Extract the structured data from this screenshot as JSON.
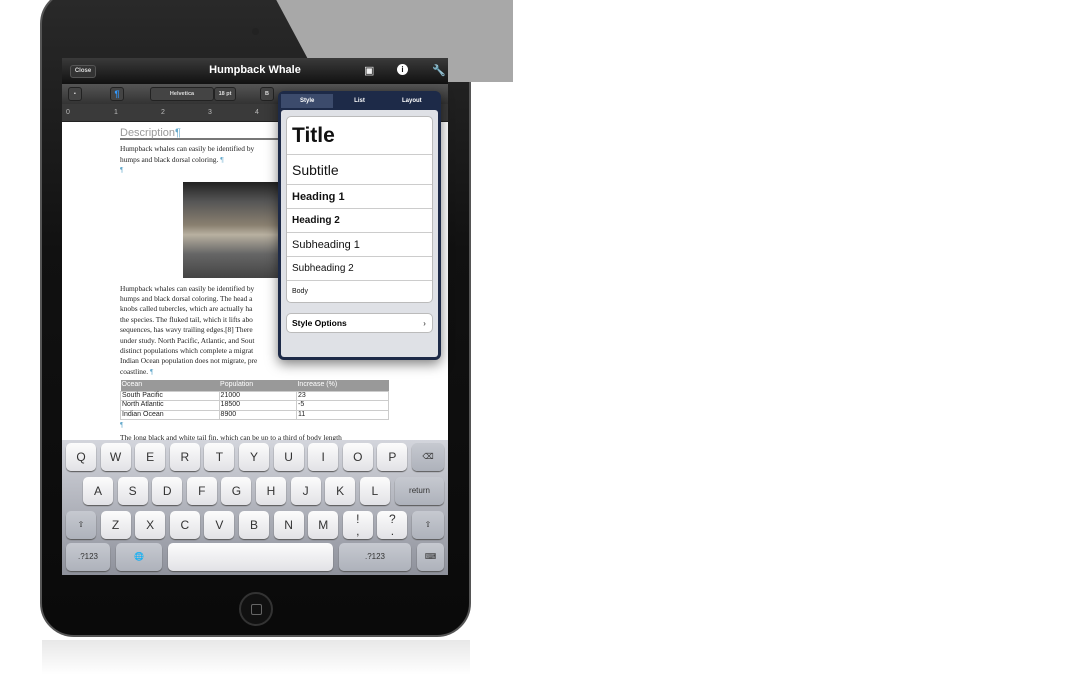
{
  "app": {
    "title": "Humpback Whale",
    "close_label": "Close"
  },
  "toolbar": {
    "font": "Helvetica",
    "size": "18 pt"
  },
  "ruler": [
    "0",
    "1",
    "2",
    "3",
    "4"
  ],
  "doc": {
    "heading": "Description",
    "para1": "Humpback whales can easily be identified by",
    "para1b": "humps and black dorsal coloring.",
    "para2": [
      "Humpback whales can easily be identified by",
      "humps and black dorsal coloring. The head a",
      "knobs called tubercles, which are actually ha",
      "the species. The fluked tail, which it lifts abo",
      "sequences, has wavy trailing edges.[8] There",
      "under study. North Pacific, Atlantic, and Sout",
      "distinct populations which complete a migrat",
      "Indian Ocean population does not migrate, pre",
      "coastline."
    ],
    "table": {
      "headers": [
        "Ocean",
        "Population",
        "Increase (%)"
      ],
      "rows": [
        [
          "South Pacific",
          "21000",
          "23"
        ],
        [
          "North Atlantic",
          "18500",
          "-5"
        ],
        [
          "Indian Ocean",
          "8900",
          "11"
        ]
      ]
    },
    "para3": "The long black and white tail fin, which can be up to a third of body length"
  },
  "popover": {
    "tabs": [
      "Style",
      "List",
      "Layout"
    ],
    "styles": [
      "Title",
      "Subtitle",
      "Heading 1",
      "Heading 2",
      "Subheading 1",
      "Subheading 2",
      "Body"
    ],
    "options_label": "Style Options"
  },
  "keyboard": {
    "row1": [
      "Q",
      "W",
      "E",
      "R",
      "T",
      "Y",
      "U",
      "I",
      "O",
      "P"
    ],
    "row2": [
      "A",
      "S",
      "D",
      "F",
      "G",
      "H",
      "J",
      "K",
      "L"
    ],
    "row3": [
      "Z",
      "X",
      "C",
      "V",
      "B",
      "N",
      "M",
      "!\n,",
      "?\n."
    ],
    "return": "return",
    "numbers": ".?123"
  }
}
